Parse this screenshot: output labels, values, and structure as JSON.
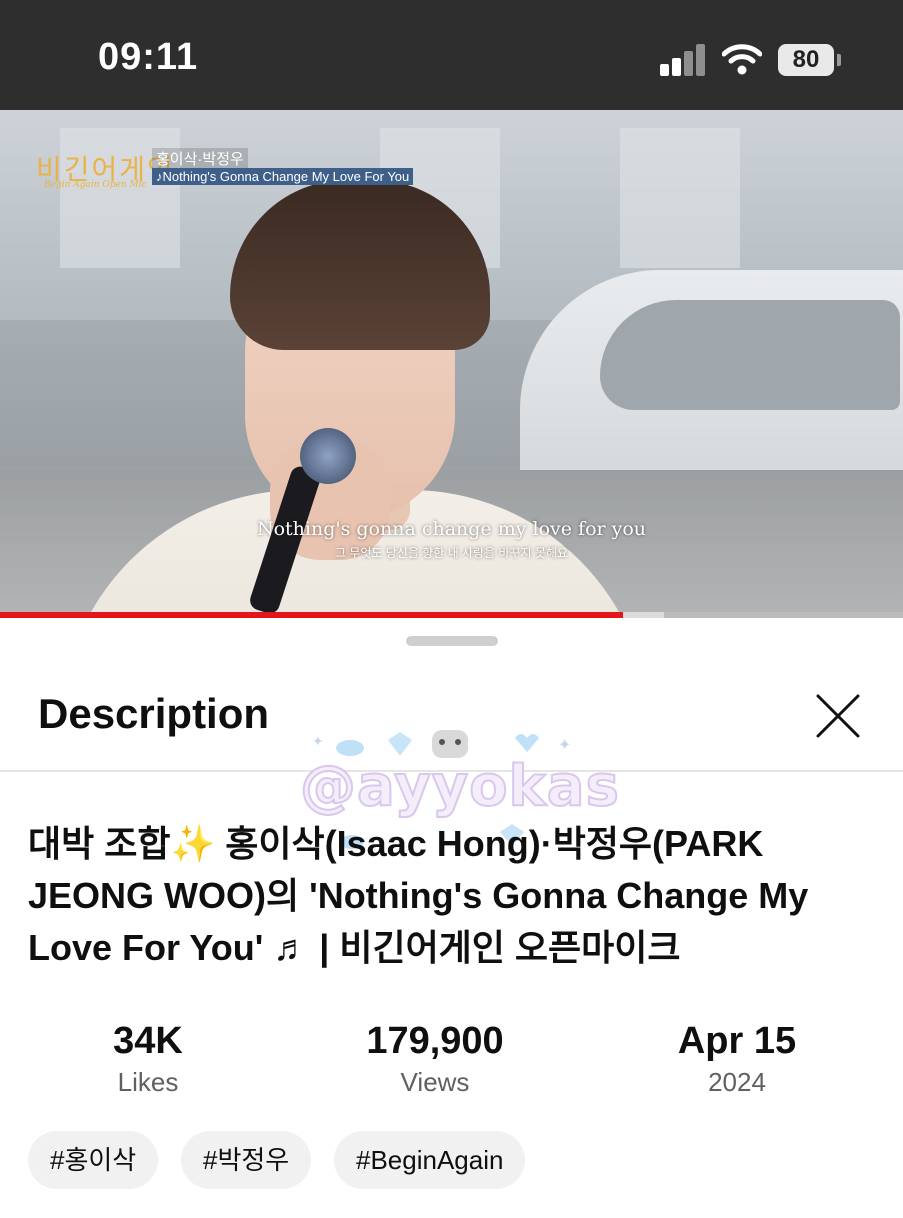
{
  "status_bar": {
    "time": "09:11",
    "battery": "80"
  },
  "video": {
    "show_logo": "비긴어게인",
    "show_logo_sub": "Begin Again Open Mic",
    "performers": "홍이삭·박정우",
    "song_caption": "♪Nothing's Gonna Change My Love For You",
    "subtitle_en": "Nothing's gonna change my love for you",
    "subtitle_ko": "그 무엇도 당신을 향한 내 사랑을 바꾸지 못해요",
    "progress": 0.69,
    "buffered": 0.735,
    "progress_color": "#e4161b"
  },
  "sheet": {
    "title": "Description",
    "watermark": "@ayyokas",
    "video_title_line1": "대박 조합✨ 홍이삭(Isaac Hong)·박정우(PARK",
    "video_title_line2": "JEONG WOO)의 'Nothing's Gonna Change My",
    "video_title_line3": "Love For You' ♬ | 비긴어게인 오픈마이크",
    "stats": [
      {
        "value": "34K",
        "label": "Likes"
      },
      {
        "value": "179,900",
        "label": "Views"
      },
      {
        "value": "Apr 15",
        "label": "2024"
      }
    ],
    "hashtags": [
      "#홍이삭",
      "#박정우",
      "#BeginAgain"
    ]
  }
}
